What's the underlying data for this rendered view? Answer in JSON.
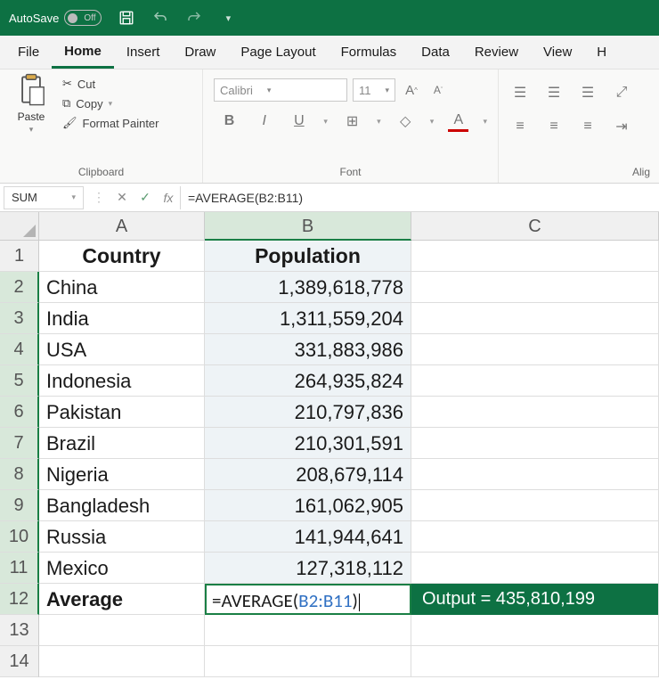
{
  "titlebar": {
    "autosave_label": "AutoSave",
    "autosave_state": "Off"
  },
  "tabs": [
    "File",
    "Home",
    "Insert",
    "Draw",
    "Page Layout",
    "Formulas",
    "Data",
    "Review",
    "View",
    "H"
  ],
  "active_tab_index": 1,
  "ribbon": {
    "clipboard": {
      "paste": "Paste",
      "cut": "Cut",
      "copy": "Copy",
      "fp": "Format Painter",
      "label": "Clipboard"
    },
    "font": {
      "name": "Calibri",
      "size": "11",
      "bold": "B",
      "italic": "I",
      "underline": "U",
      "label": "Font",
      "incA": "A",
      "decA": "A"
    },
    "align": {
      "label": "Alig"
    }
  },
  "formula_bar": {
    "name": "SUM",
    "fx": "fx",
    "formula": "=AVERAGE(B2:B11)"
  },
  "columns": [
    "A",
    "B",
    "C"
  ],
  "rows": [
    "1",
    "2",
    "3",
    "4",
    "5",
    "6",
    "7",
    "8",
    "9",
    "10",
    "11",
    "12",
    "13",
    "14"
  ],
  "table": {
    "headers": {
      "a": "Country",
      "b": "Population"
    },
    "data": [
      {
        "a": "China",
        "b": "1,389,618,778"
      },
      {
        "a": "India",
        "b": "1,311,559,204"
      },
      {
        "a": "USA",
        "b": "331,883,986"
      },
      {
        "a": "Indonesia",
        "b": "264,935,824"
      },
      {
        "a": "Pakistan",
        "b": "210,797,836"
      },
      {
        "a": "Brazil",
        "b": "210,301,591"
      },
      {
        "a": "Nigeria",
        "b": "208,679,114"
      },
      {
        "a": "Bangladesh",
        "b": "161,062,905"
      },
      {
        "a": "Russia",
        "b": "141,944,641"
      },
      {
        "a": "Mexico",
        "b": "127,318,112"
      }
    ],
    "avg_label": "Average",
    "avg_formula_prefix": "=AVERAGE(",
    "avg_formula_ref": "B2:B11",
    "avg_formula_suffix": ")",
    "output_text": "Output = 435,810,199"
  }
}
